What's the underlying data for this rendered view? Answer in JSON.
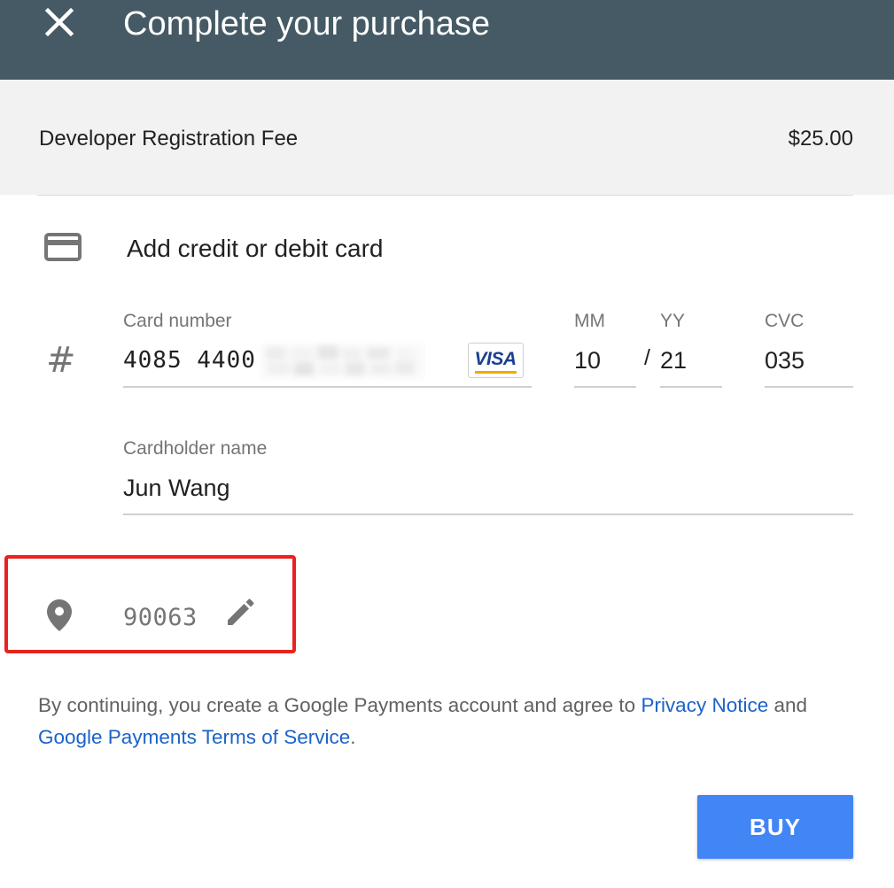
{
  "header": {
    "title": "Complete your purchase",
    "close_icon": "close-icon",
    "background_color": "#455a64"
  },
  "order": {
    "item_name": "Developer Registration Fee",
    "price": "$25.00"
  },
  "payment": {
    "section_title": "Add credit or debit card",
    "card_icon": "credit-card-icon",
    "card_number": {
      "label": "Card number",
      "value": "4085 4400",
      "brand": "VISA",
      "hash_icon": "#"
    },
    "expiry": {
      "month_label": "MM",
      "month_value": "10",
      "separator": "/",
      "year_label": "YY",
      "year_value": "21"
    },
    "cvc": {
      "label": "CVC",
      "value": "035"
    },
    "cardholder": {
      "label": "Cardholder name",
      "value": "Jun Wang"
    },
    "postal_code": {
      "value": "90063",
      "location_icon": "location-pin-icon",
      "edit_icon": "edit-pencil-icon"
    }
  },
  "legal": {
    "text_before": "By continuing, you create a Google Payments account and agree to ",
    "privacy_link": "Privacy Notice",
    "text_middle": " and ",
    "terms_link": "Google Payments Terms of Service",
    "text_after": "."
  },
  "actions": {
    "buy_label": "BUY"
  },
  "colors": {
    "accent": "#4285f4",
    "link": "#1a63c9",
    "highlight": "#e8231f"
  }
}
